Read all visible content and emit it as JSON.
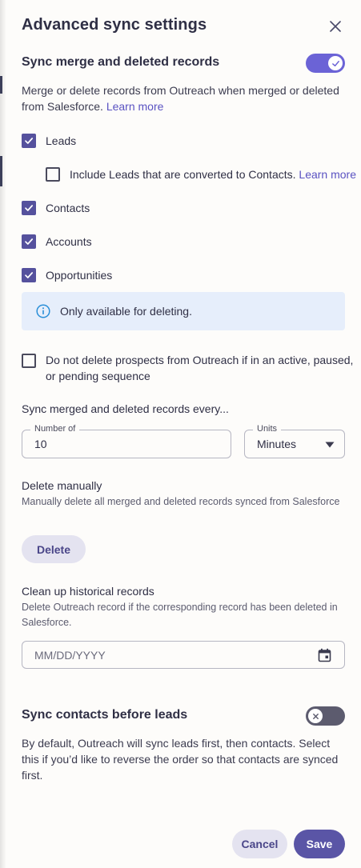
{
  "dialog": {
    "title": "Advanced sync settings"
  },
  "merge_section": {
    "title": "Sync merge and deleted records",
    "toggle_on": true,
    "description": "Merge or delete records from Outreach when merged or deleted from Salesforce.",
    "learn_more": "Learn more",
    "checkboxes": {
      "leads": {
        "label": "Leads",
        "checked": true
      },
      "include_converted": {
        "label": "Include Leads that are converted to Contacts.",
        "link": "Learn more",
        "checked": false
      },
      "contacts": {
        "label": "Contacts",
        "checked": true
      },
      "accounts": {
        "label": "Accounts",
        "checked": true
      },
      "opportunities": {
        "label": "Opportunities",
        "checked": true
      }
    },
    "info_text": "Only available for deleting.",
    "do_not_delete": {
      "label": "Do not delete prospects from Outreach if in an active, paused, or pending sequence",
      "checked": false
    },
    "frequency_label": "Sync merged and deleted records every...",
    "number_field": {
      "legend": "Number of",
      "value": "10"
    },
    "units_field": {
      "legend": "Units",
      "value": "Minutes"
    }
  },
  "delete_manually": {
    "title": "Delete manually",
    "description": "Manually delete all merged and deleted records synced from Salesforce",
    "button": "Delete"
  },
  "cleanup": {
    "title": "Clean up historical records",
    "description": "Delete Outreach record if the corresponding record has been deleted in Salesforce.",
    "date_placeholder": "MM/DD/YYYY"
  },
  "contacts_first": {
    "title": "Sync contacts before leads",
    "toggle_on": false,
    "description": "By default, Outreach will sync leads first, then contacts. Select this if you’d like to reverse the order so that contacts are synced first."
  },
  "footer": {
    "cancel": "Cancel",
    "save": "Save"
  },
  "colors": {
    "accent": "#6b63d6",
    "checkbox": "#55519d",
    "link": "#5a52c2",
    "info_bg": "#e6eefb",
    "info_icon": "#2a8fd8"
  },
  "icons": [
    "close-icon",
    "check-icon",
    "info-icon",
    "caret-down-icon",
    "calendar-icon",
    "x-icon"
  ]
}
